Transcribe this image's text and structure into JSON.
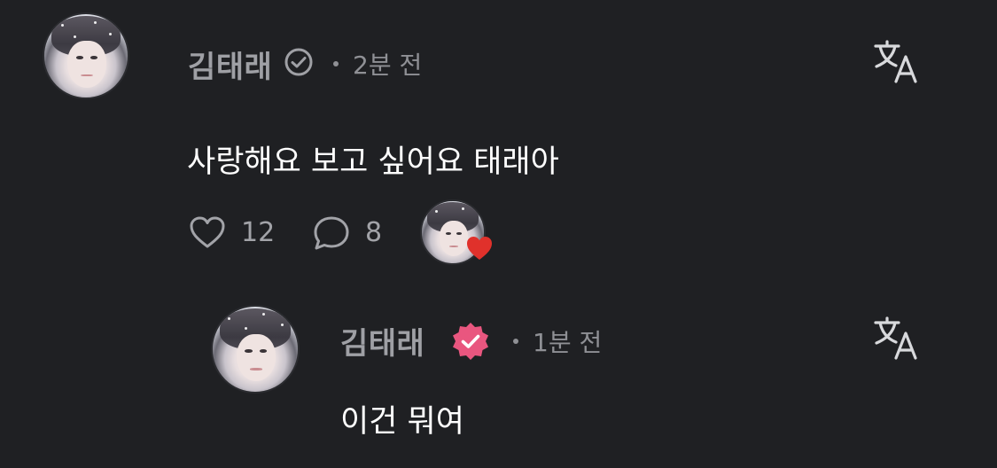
{
  "comment": {
    "username": "김태래",
    "time": "2분 전",
    "text": "사랑해요 보고 싶어요 태래아",
    "likes": "12",
    "replies": "8"
  },
  "reply": {
    "username": "김태래",
    "time": "1분 전",
    "text": "이건 뭐여"
  },
  "colors": {
    "background": "#1f2023",
    "username": "#9fa0a5",
    "meta": "#8f9095",
    "text": "#ffffff",
    "verified_badge": "#e9567f",
    "heart": "#e0312b"
  },
  "icons": {
    "verified_outline": "check-circle-icon",
    "verified_badge": "verified-badge-icon",
    "translate": "translate-icon",
    "like": "heart-outline-icon",
    "reply": "speech-bubble-icon",
    "creator_heart": "heart-filled-icon"
  }
}
